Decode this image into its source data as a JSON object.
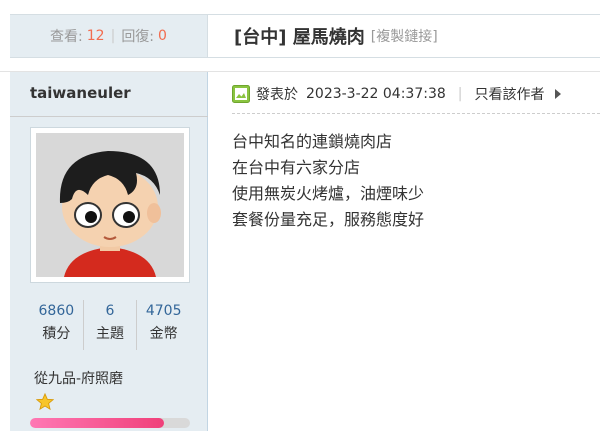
{
  "header": {
    "views_label": "查看:",
    "views_count": "12",
    "replies_label": "回復:",
    "replies_count": "0",
    "separator": "|",
    "title": "[台中] 屋馬燒肉",
    "copy_link_label": "[複製鏈接]"
  },
  "author": {
    "name": "taiwaneuler",
    "stats": [
      {
        "value": "6860",
        "label": "積分"
      },
      {
        "value": "6",
        "label": "主題"
      },
      {
        "value": "4705",
        "label": "金幣"
      }
    ],
    "rank": "從九品-府照磨",
    "level_progress": 0.84
  },
  "post": {
    "posted_label": "發表於",
    "posted_time": "2023-3-22 04:37:38",
    "separator": "|",
    "author_only_label": "只看該作者",
    "lines": [
      "台中知名的連鎖燒肉店",
      "在台中有六家分店",
      "使用無炭火烤爐，油煙味少",
      "套餐份量充足，服務態度好"
    ]
  },
  "colors": {
    "sidebar_bg": "#e5edf2",
    "count_highlight": "#f26c4f",
    "stat_value": "#336699",
    "level_bar": "#f0407a"
  },
  "icons": {
    "post_status": "green-post-icon",
    "rank_star": "star-icon",
    "expand": "arrow-right-icon"
  }
}
